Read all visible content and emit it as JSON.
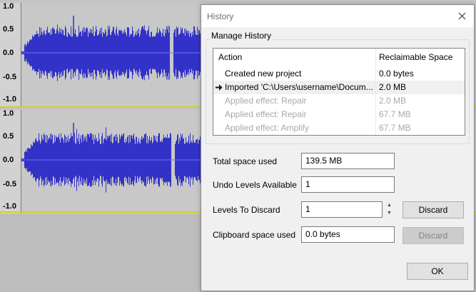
{
  "tracks": {
    "axis_labels": [
      "1.0",
      "0.5",
      "0.0",
      "-0.5",
      "-1.0"
    ],
    "waveform_color": "#3232c8",
    "count": 2
  },
  "dialog": {
    "title": "History",
    "close_icon": "close-icon",
    "group_label": "Manage History",
    "columns": {
      "action": "Action",
      "space": "Reclaimable Space"
    },
    "rows": [
      {
        "action": "Created new project",
        "space": "0.0 bytes",
        "state": "past"
      },
      {
        "action": "Imported 'C:\\Users\\username\\Docum...",
        "space": "2.0 MB",
        "state": "current"
      },
      {
        "action": "Applied effect: Repair",
        "space": "2.0 MB",
        "state": "future"
      },
      {
        "action": "Applied effect: Repair",
        "space": "67.7 MB",
        "state": "future"
      },
      {
        "action": "Applied effect: Amplify",
        "space": "67.7 MB",
        "state": "future"
      }
    ],
    "total_space_label": "Total space used",
    "total_space_value": "139.5 MB",
    "undo_levels_label": "Undo Levels Available",
    "undo_levels_value": "1",
    "levels_discard_label": "Levels To Discard",
    "levels_discard_value": "1",
    "discard_label": "Discard",
    "clipboard_label": "Clipboard space used",
    "clipboard_value": "0.0 bytes",
    "clipboard_discard_label": "Discard",
    "ok_label": "OK",
    "current_marker_icon": "arrow-right-icon"
  }
}
